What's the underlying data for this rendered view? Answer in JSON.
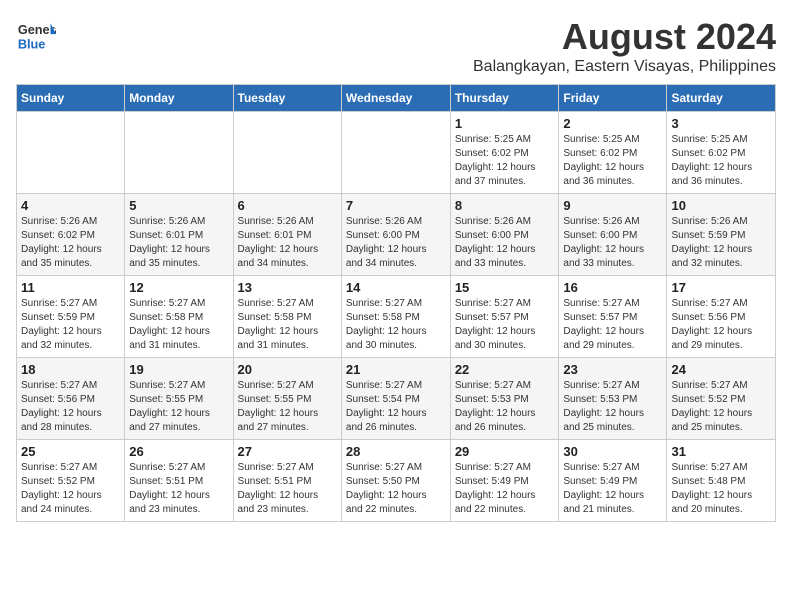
{
  "logo": {
    "general": "General",
    "blue": "Blue"
  },
  "title": "August 2024",
  "subtitle": "Balangkayan, Eastern Visayas, Philippines",
  "weekdays": [
    "Sunday",
    "Monday",
    "Tuesday",
    "Wednesday",
    "Thursday",
    "Friday",
    "Saturday"
  ],
  "weeks": [
    [
      {
        "day": "",
        "info": ""
      },
      {
        "day": "",
        "info": ""
      },
      {
        "day": "",
        "info": ""
      },
      {
        "day": "",
        "info": ""
      },
      {
        "day": "1",
        "info": "Sunrise: 5:25 AM\nSunset: 6:02 PM\nDaylight: 12 hours\nand 37 minutes."
      },
      {
        "day": "2",
        "info": "Sunrise: 5:25 AM\nSunset: 6:02 PM\nDaylight: 12 hours\nand 36 minutes."
      },
      {
        "day": "3",
        "info": "Sunrise: 5:25 AM\nSunset: 6:02 PM\nDaylight: 12 hours\nand 36 minutes."
      }
    ],
    [
      {
        "day": "4",
        "info": "Sunrise: 5:26 AM\nSunset: 6:02 PM\nDaylight: 12 hours\nand 35 minutes."
      },
      {
        "day": "5",
        "info": "Sunrise: 5:26 AM\nSunset: 6:01 PM\nDaylight: 12 hours\nand 35 minutes."
      },
      {
        "day": "6",
        "info": "Sunrise: 5:26 AM\nSunset: 6:01 PM\nDaylight: 12 hours\nand 34 minutes."
      },
      {
        "day": "7",
        "info": "Sunrise: 5:26 AM\nSunset: 6:00 PM\nDaylight: 12 hours\nand 34 minutes."
      },
      {
        "day": "8",
        "info": "Sunrise: 5:26 AM\nSunset: 6:00 PM\nDaylight: 12 hours\nand 33 minutes."
      },
      {
        "day": "9",
        "info": "Sunrise: 5:26 AM\nSunset: 6:00 PM\nDaylight: 12 hours\nand 33 minutes."
      },
      {
        "day": "10",
        "info": "Sunrise: 5:26 AM\nSunset: 5:59 PM\nDaylight: 12 hours\nand 32 minutes."
      }
    ],
    [
      {
        "day": "11",
        "info": "Sunrise: 5:27 AM\nSunset: 5:59 PM\nDaylight: 12 hours\nand 32 minutes."
      },
      {
        "day": "12",
        "info": "Sunrise: 5:27 AM\nSunset: 5:58 PM\nDaylight: 12 hours\nand 31 minutes."
      },
      {
        "day": "13",
        "info": "Sunrise: 5:27 AM\nSunset: 5:58 PM\nDaylight: 12 hours\nand 31 minutes."
      },
      {
        "day": "14",
        "info": "Sunrise: 5:27 AM\nSunset: 5:58 PM\nDaylight: 12 hours\nand 30 minutes."
      },
      {
        "day": "15",
        "info": "Sunrise: 5:27 AM\nSunset: 5:57 PM\nDaylight: 12 hours\nand 30 minutes."
      },
      {
        "day": "16",
        "info": "Sunrise: 5:27 AM\nSunset: 5:57 PM\nDaylight: 12 hours\nand 29 minutes."
      },
      {
        "day": "17",
        "info": "Sunrise: 5:27 AM\nSunset: 5:56 PM\nDaylight: 12 hours\nand 29 minutes."
      }
    ],
    [
      {
        "day": "18",
        "info": "Sunrise: 5:27 AM\nSunset: 5:56 PM\nDaylight: 12 hours\nand 28 minutes."
      },
      {
        "day": "19",
        "info": "Sunrise: 5:27 AM\nSunset: 5:55 PM\nDaylight: 12 hours\nand 27 minutes."
      },
      {
        "day": "20",
        "info": "Sunrise: 5:27 AM\nSunset: 5:55 PM\nDaylight: 12 hours\nand 27 minutes."
      },
      {
        "day": "21",
        "info": "Sunrise: 5:27 AM\nSunset: 5:54 PM\nDaylight: 12 hours\nand 26 minutes."
      },
      {
        "day": "22",
        "info": "Sunrise: 5:27 AM\nSunset: 5:53 PM\nDaylight: 12 hours\nand 26 minutes."
      },
      {
        "day": "23",
        "info": "Sunrise: 5:27 AM\nSunset: 5:53 PM\nDaylight: 12 hours\nand 25 minutes."
      },
      {
        "day": "24",
        "info": "Sunrise: 5:27 AM\nSunset: 5:52 PM\nDaylight: 12 hours\nand 25 minutes."
      }
    ],
    [
      {
        "day": "25",
        "info": "Sunrise: 5:27 AM\nSunset: 5:52 PM\nDaylight: 12 hours\nand 24 minutes."
      },
      {
        "day": "26",
        "info": "Sunrise: 5:27 AM\nSunset: 5:51 PM\nDaylight: 12 hours\nand 23 minutes."
      },
      {
        "day": "27",
        "info": "Sunrise: 5:27 AM\nSunset: 5:51 PM\nDaylight: 12 hours\nand 23 minutes."
      },
      {
        "day": "28",
        "info": "Sunrise: 5:27 AM\nSunset: 5:50 PM\nDaylight: 12 hours\nand 22 minutes."
      },
      {
        "day": "29",
        "info": "Sunrise: 5:27 AM\nSunset: 5:49 PM\nDaylight: 12 hours\nand 22 minutes."
      },
      {
        "day": "30",
        "info": "Sunrise: 5:27 AM\nSunset: 5:49 PM\nDaylight: 12 hours\nand 21 minutes."
      },
      {
        "day": "31",
        "info": "Sunrise: 5:27 AM\nSunset: 5:48 PM\nDaylight: 12 hours\nand 20 minutes."
      }
    ]
  ]
}
